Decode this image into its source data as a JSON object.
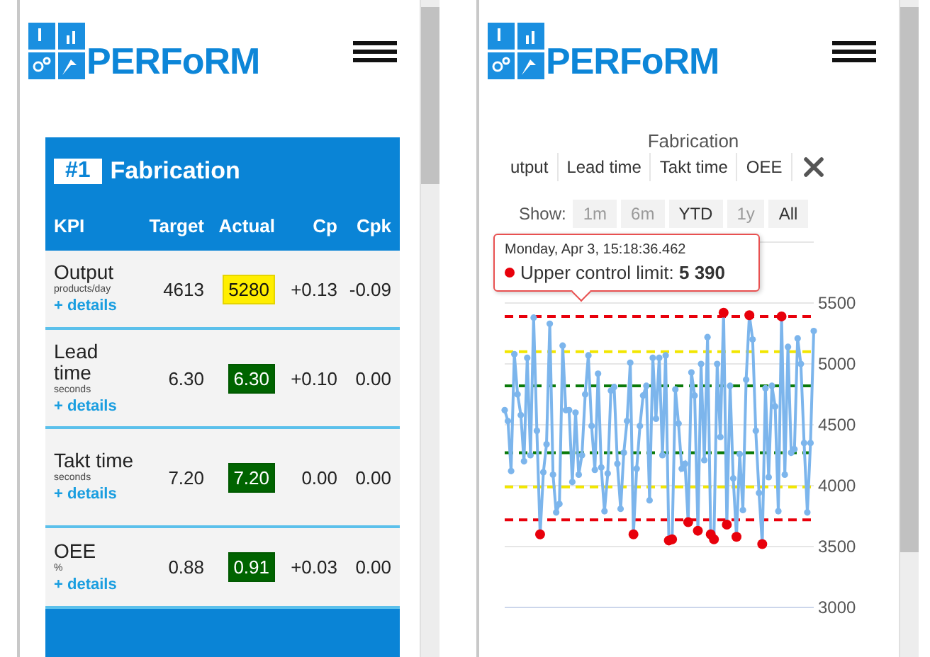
{
  "left_panel": {
    "logo": {
      "text": "PERFoRM"
    },
    "card": {
      "number": "#1",
      "title": "Fabrication",
      "columns": [
        "KPI",
        "Target",
        "Actual",
        "Cp",
        "Cpk"
      ],
      "rows": [
        {
          "name": "Output",
          "unit": "products/day",
          "details": "+ details",
          "target": "4613",
          "actual": "5280",
          "color": "#ffee00",
          "cp": "+0.13",
          "cpk": "-0.09"
        },
        {
          "name": "Lead time",
          "unit": "seconds",
          "details": "+ details",
          "target": "6.30",
          "actual": "6.30",
          "color": "#006400",
          "cp": "+0.10",
          "cpk": "0.00"
        },
        {
          "name": "Takt time",
          "unit": "seconds",
          "details": "+ details",
          "target": "7.20",
          "actual": "7.20",
          "color": "#006400",
          "cp": "0.00",
          "cpk": "0.00"
        },
        {
          "name": "OEE",
          "unit": "%",
          "details": "+ details",
          "target": "0.88",
          "actual": "0.91",
          "color": "#006400",
          "cp": "+0.03",
          "cpk": "0.00"
        }
      ]
    }
  },
  "right_panel": {
    "logo": {
      "text": "PERFoRM"
    },
    "title": "Fabrication",
    "tabs": [
      "utput",
      "Lead time",
      "Takt time",
      "OEE"
    ],
    "show_label": "Show:",
    "ranges": [
      {
        "label": "1m",
        "disabled": true
      },
      {
        "label": "6m",
        "disabled": true
      },
      {
        "label": "YTD",
        "disabled": false
      },
      {
        "label": "1y",
        "disabled": true
      },
      {
        "label": "All",
        "disabled": false
      }
    ],
    "tooltip": {
      "date": "Monday, Apr 3, 15:18:36.462",
      "text": "Upper control limit: **5 390**",
      "color": "#e8000b"
    },
    "chart_data": {
      "type": "line",
      "grid": true,
      "ylim": [
        3000,
        6000
      ],
      "yticks": [
        3000,
        3500,
        4000,
        4500,
        5000,
        5500
      ],
      "series": [
        {
          "color": "#7cb5ec",
          "marker": true,
          "values": [
            4620,
            4530,
            4120,
            5080,
            4750,
            4580,
            4200,
            5050,
            4250,
            5380,
            4450,
            3600,
            4110,
            4340,
            5330,
            4090,
            3780,
            3850,
            5150,
            4620,
            4620,
            4030,
            4600,
            4090,
            4250,
            4750,
            5070,
            4490,
            4130,
            4920,
            4150,
            3790,
            4100,
            4780,
            4810,
            4180,
            3810,
            4270,
            4530,
            5010,
            3600,
            4140,
            4490,
            4740,
            4820,
            3880,
            5050,
            4550,
            5050,
            4250,
            5070,
            3550,
            3560,
            4790,
            4510,
            4140,
            4180,
            3700,
            4930,
            4740,
            3630,
            5000,
            4210,
            5220,
            3600,
            3560,
            5000,
            4400,
            5420,
            3680,
            4820,
            4060,
            3580,
            4260,
            3800,
            4870,
            5400,
            5200,
            4450,
            3940,
            3520,
            4800,
            4070,
            4820,
            4650,
            3790,
            5390,
            4090,
            5140,
            4270,
            4300,
            5210,
            5000,
            4350,
            3780,
            4350,
            5270
          ]
        },
        {
          "color": "#e8000b",
          "line_style": "dashed",
          "values": [
            5390,
            5390,
            5390,
            5390,
            5390,
            5390,
            5390,
            5390,
            5390,
            5390,
            5390,
            5390,
            5390,
            5390,
            5390,
            5390,
            5390,
            5390,
            5390,
            5390,
            5390,
            5390,
            5390,
            5390,
            5390,
            5390,
            5390,
            5390,
            5390,
            5390,
            5390,
            5390,
            5390,
            5390,
            5390,
            5390,
            5390,
            5390,
            5390,
            5390,
            5390,
            5390,
            5390,
            5390,
            5390,
            5390,
            5390,
            5390,
            5390,
            5390,
            5390,
            5390,
            5390,
            5390,
            5390,
            5390,
            5390,
            5390,
            5390,
            5390,
            5390,
            5390,
            5390,
            5390,
            5390,
            5390,
            5390,
            5390,
            5390,
            5390,
            5390,
            5390,
            5390,
            5390,
            5390,
            5390,
            5390,
            5390,
            5390,
            5390,
            5390,
            5390,
            5390,
            5390,
            5390,
            5390,
            5390,
            5390,
            5390,
            5390,
            5390,
            5390,
            5390,
            5390,
            5390,
            5390,
            5390
          ]
        },
        {
          "color": "#f2e600",
          "line_style": "dashed",
          "values": [
            5100,
            5100,
            5100,
            5100,
            5100,
            5100,
            5100,
            5100,
            5100,
            5100,
            5100,
            5100,
            5100,
            5100,
            5100,
            5100,
            5100,
            5100,
            5100,
            5100,
            5100,
            5100,
            5100,
            5100,
            5100,
            5100,
            5100,
            5100,
            5100,
            5100,
            5100,
            5100,
            5100,
            5100,
            5100,
            5100,
            5100,
            5100,
            5100,
            5100,
            5100,
            5100,
            5100,
            5100,
            5100,
            5100,
            5100,
            5100,
            5100,
            5100,
            5100,
            5100,
            5100,
            5100,
            5100,
            5100,
            5100,
            5100,
            5100,
            5100,
            5100,
            5100,
            5100,
            5100,
            5100,
            5100,
            5100,
            5100,
            5100,
            5100,
            5100,
            5100,
            5100,
            5100,
            5100,
            5100,
            5100,
            5100,
            5100,
            5100,
            5100,
            5100,
            5100,
            5100,
            5100,
            5100,
            5100,
            5100,
            5100,
            5100,
            5100,
            5100,
            5100,
            5100,
            5100,
            5100,
            5100
          ]
        },
        {
          "color": "#0a7a0a",
          "line_style": "dashed",
          "values": [
            4820,
            4820,
            4820,
            4820,
            4820,
            4820,
            4820,
            4820,
            4820,
            4820,
            4820,
            4820,
            4820,
            4820,
            4820,
            4820,
            4820,
            4820,
            4820,
            4820,
            4820,
            4820,
            4820,
            4820,
            4820,
            4820,
            4820,
            4820,
            4820,
            4820,
            4820,
            4820,
            4820,
            4820,
            4820,
            4820,
            4820,
            4820,
            4820,
            4820,
            4820,
            4820,
            4820,
            4820,
            4820,
            4820,
            4820,
            4820,
            4820,
            4820,
            4820,
            4820,
            4820,
            4820,
            4820,
            4820,
            4820,
            4820,
            4820,
            4820,
            4820,
            4820,
            4820,
            4820,
            4820,
            4820,
            4820,
            4820,
            4820,
            4820,
            4820,
            4820,
            4820,
            4820,
            4820,
            4820,
            4820,
            4820,
            4820,
            4820,
            4820,
            4820,
            4820,
            4820,
            4820,
            4820,
            4820,
            4820,
            4820,
            4820,
            4820,
            4820,
            4820,
            4820,
            4820,
            4820,
            4820
          ]
        },
        {
          "color": "#0a7a0a",
          "line_style": "dashed",
          "values": [
            4270,
            4270,
            4270,
            4270,
            4270,
            4270,
            4270,
            4270,
            4270,
            4270,
            4270,
            4270,
            4270,
            4270,
            4270,
            4270,
            4270,
            4270,
            4270,
            4270,
            4270,
            4270,
            4270,
            4270,
            4270,
            4270,
            4270,
            4270,
            4270,
            4270,
            4270,
            4270,
            4270,
            4270,
            4270,
            4270,
            4270,
            4270,
            4270,
            4270,
            4270,
            4270,
            4270,
            4270,
            4270,
            4270,
            4270,
            4270,
            4270,
            4270,
            4270,
            4270,
            4270,
            4270,
            4270,
            4270,
            4270,
            4270,
            4270,
            4270,
            4270,
            4270,
            4270,
            4270,
            4270,
            4270,
            4270,
            4270,
            4270,
            4270,
            4270,
            4270,
            4270,
            4270,
            4270,
            4270,
            4270,
            4270,
            4270,
            4270,
            4270,
            4270,
            4270,
            4270,
            4270,
            4270,
            4270,
            4270,
            4270,
            4270,
            4270,
            4270,
            4270,
            4270,
            4270,
            4270,
            4270
          ]
        },
        {
          "color": "#f2e600",
          "line_style": "dashed",
          "values": [
            3990,
            3990,
            3990,
            3990,
            3990,
            3990,
            3990,
            3990,
            3990,
            3990,
            3990,
            3990,
            3990,
            3990,
            3990,
            3990,
            3990,
            3990,
            3990,
            3990,
            3990,
            3990,
            3990,
            3990,
            3990,
            3990,
            3990,
            3990,
            3990,
            3990,
            3990,
            3990,
            3990,
            3990,
            3990,
            3990,
            3990,
            3990,
            3990,
            3990,
            3990,
            3990,
            3990,
            3990,
            3990,
            3990,
            3990,
            3990,
            3990,
            3990,
            3990,
            3990,
            3990,
            3990,
            3990,
            3990,
            3990,
            3990,
            3990,
            3990,
            3990,
            3990,
            3990,
            3990,
            3990,
            3990,
            3990,
            3990,
            3990,
            3990,
            3990,
            3990,
            3990,
            3990,
            3990,
            3990,
            3990,
            3990,
            3990,
            3990,
            3990,
            3990,
            3990,
            3990,
            3990,
            3990,
            3990,
            3990,
            3990,
            3990,
            3990,
            3990,
            3990,
            3990,
            3990,
            3990,
            3990
          ]
        },
        {
          "color": "#e8000b",
          "line_style": "dashed",
          "values": [
            3720,
            3720,
            3720,
            3720,
            3720,
            3720,
            3720,
            3720,
            3720,
            3720,
            3720,
            3720,
            3720,
            3720,
            3720,
            3720,
            3720,
            3720,
            3720,
            3720,
            3720,
            3720,
            3720,
            3720,
            3720,
            3720,
            3720,
            3720,
            3720,
            3720,
            3720,
            3720,
            3720,
            3720,
            3720,
            3720,
            3720,
            3720,
            3720,
            3720,
            3720,
            3720,
            3720,
            3720,
            3720,
            3720,
            3720,
            3720,
            3720,
            3720,
            3720,
            3720,
            3720,
            3720,
            3720,
            3720,
            3720,
            3720,
            3720,
            3720,
            3720,
            3720,
            3720,
            3720,
            3720,
            3720,
            3720,
            3720,
            3720,
            3720,
            3720,
            3720,
            3720,
            3720,
            3720,
            3720,
            3720,
            3720,
            3720,
            3720,
            3720,
            3720,
            3720,
            3720,
            3720,
            3720,
            3720,
            3720,
            3720,
            3720,
            3720,
            3720,
            3720,
            3720,
            3720,
            3720,
            3720
          ]
        }
      ]
    }
  }
}
